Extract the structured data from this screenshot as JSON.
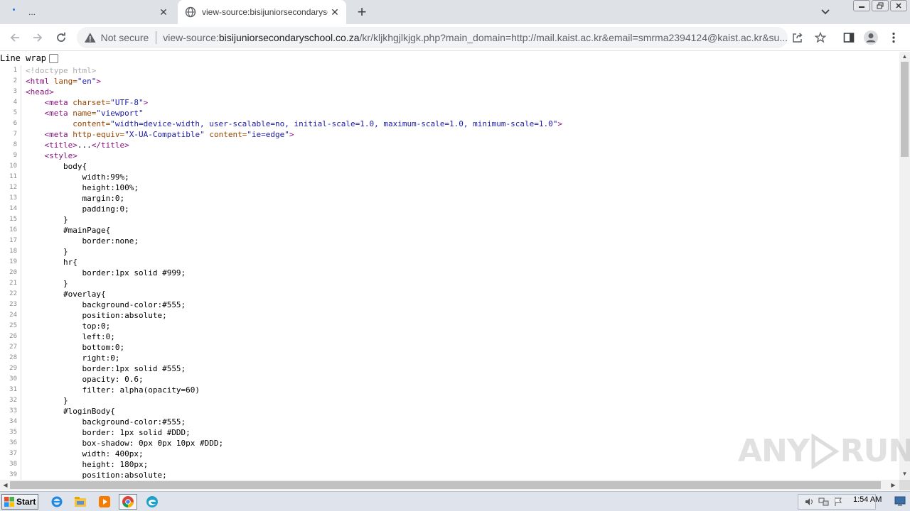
{
  "tabs": [
    {
      "title": "...",
      "state": "loading"
    },
    {
      "title": "view-source:bisijuniorsecondaryschool",
      "state": "active"
    }
  ],
  "toolbar": {
    "security_label": "Not secure",
    "url_scheme": "view-source:",
    "url_host": "bisijuniorsecondaryschool.co.za",
    "url_path": "/kr/kljkhgjlkjgk.php?main_domain=http://mail.kaist.ac.kr&email=smrma2394124@kaist.ac.kr&su..."
  },
  "line_wrap": {
    "label": "Line wrap",
    "checked": false
  },
  "source_lines": [
    "1",
    "2",
    "3",
    "4",
    "5",
    "6",
    "7",
    "8",
    "9",
    "10",
    "11",
    "12",
    "13",
    "14",
    "15",
    "16",
    "17",
    "18",
    "19",
    "20",
    "21",
    "22",
    "23",
    "24",
    "25",
    "26",
    "27",
    "28",
    "29",
    "30",
    "31",
    "32",
    "33",
    "34",
    "35",
    "36",
    "37",
    "38",
    "39"
  ],
  "code": {
    "l1": "<!doctype html>",
    "l2_tag": "<html",
    "l2_attr": "lang=",
    "l2_val": "\"en\"",
    "l3": "<head>",
    "l4_tag": "<meta",
    "l4_attr": "charset=",
    "l4_val": "\"UTF-8\"",
    "l5_tag": "<meta",
    "l5_attr": "name=",
    "l5_val": "\"viewport\"",
    "l6_attr": "content=",
    "l6_val": "\"width=device-width, user-scalable=no, initial-scale=1.0, maximum-scale=1.0, minimum-scale=1.0\"",
    "l7_tag": "<meta",
    "l7_attr1": "http-equiv=",
    "l7_val1": "\"X-UA-Compatible\"",
    "l7_attr2": "content=",
    "l7_val2": "\"ie=edge\"",
    "l8_open": "<title>",
    "l8_text": "...",
    "l8_close": "</title>",
    "l9": "<style>",
    "l10": "body{",
    "l11": "width:99%;",
    "l12": "height:100%;",
    "l13": "margin:0;",
    "l14": "padding:0;",
    "l15": "}",
    "l16": "#mainPage{",
    "l17": "border:none;",
    "l18": "}",
    "l19": "hr{",
    "l20": "border:1px solid #999;",
    "l21": "}",
    "l22": "#overlay{",
    "l23": "background-color:#555;",
    "l24": "position:absolute;",
    "l25": "top:0;",
    "l26": "left:0;",
    "l27": "bottom:0;",
    "l28": "right:0;",
    "l29": "border:1px solid #555;",
    "l30": "opacity: 0.6;",
    "l31": "filter: alpha(opacity=60)",
    "l32": "}",
    "l33": "#loginBody{",
    "l34": "background-color:#555;",
    "l35": "border: 1px solid #DDD;",
    "l36": "box-shadow: 0px 0px 10px #DDD;",
    "l37": "width: 400px;",
    "l38": "height: 180px;",
    "l39": "position:absolute;"
  },
  "watermark": {
    "left": "ANY",
    "right": "RUN"
  },
  "taskbar": {
    "start_label": "Start",
    "clock": "1:54 AM",
    "apps": [
      "internet-explorer-icon",
      "file-explorer-icon",
      "media-player-icon",
      "chrome-icon",
      "edge-icon"
    ]
  },
  "colors": {
    "tag": "#881280",
    "attr": "#994500",
    "value": "#1a1aa6",
    "comment": "#aaaaaa",
    "tabstrip": "#dee1e6",
    "omnibox": "#f1f3f4"
  }
}
